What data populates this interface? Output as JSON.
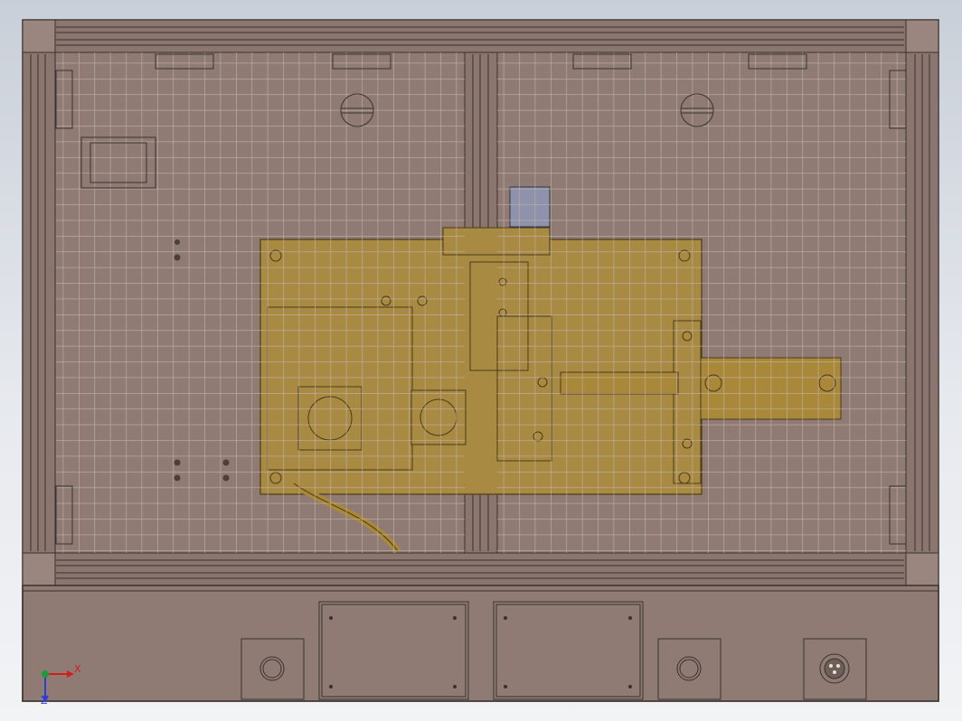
{
  "viewport": {
    "background": "gradient-gray"
  },
  "colors": {
    "frame_fill": "#8f7b74",
    "frame_line": "#3a302c",
    "glass_grid": "#b9aaa4",
    "machine_fill": "#a88a42",
    "machine_line": "#4a3a14",
    "sensor_fill": "#8e92aa",
    "cylinder_fill": "#a9883a",
    "axis_x": "#d11f1f",
    "axis_y": "#2a3fd6",
    "axis_z": "#1f9a3a"
  },
  "axes": {
    "x_label": "X",
    "y_label": "Z"
  },
  "icons": {
    "triad": "axis-triad-icon",
    "connector": "circular-connector-icon"
  }
}
